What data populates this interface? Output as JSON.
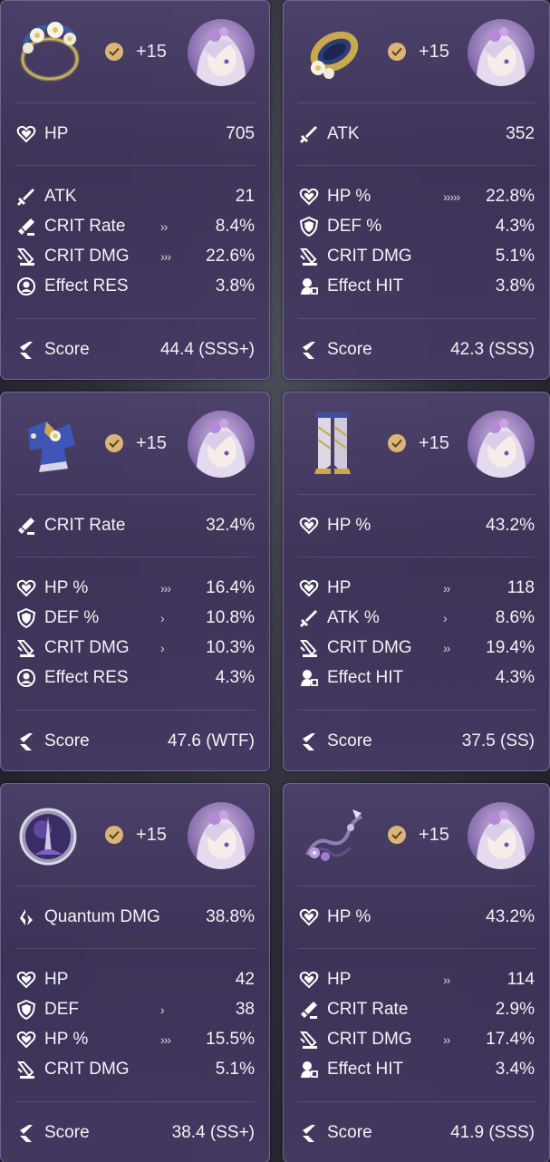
{
  "cards": [
    {
      "relic_icon": "headgear-flower-wreath-icon",
      "level": "+15",
      "main": {
        "icon": "hp-icon",
        "name": "HP",
        "value": "705"
      },
      "subs": [
        {
          "icon": "atk-icon",
          "name": "ATK",
          "rolls": "",
          "value": "21"
        },
        {
          "icon": "crit-rate-icon",
          "name": "CRIT Rate",
          "rolls": "››",
          "value": "8.4%"
        },
        {
          "icon": "crit-dmg-icon",
          "name": "CRIT DMG",
          "rolls": "›››",
          "value": "22.6%"
        },
        {
          "icon": "effect-res-icon",
          "name": "Effect RES",
          "rolls": "",
          "value": "3.8%"
        }
      ],
      "score_label": "Score",
      "score": "44.4 (SSS+)"
    },
    {
      "relic_icon": "gloves-ring-icon",
      "level": "+15",
      "main": {
        "icon": "atk-icon",
        "name": "ATK",
        "value": "352"
      },
      "subs": [
        {
          "icon": "hp-icon",
          "name": "HP %",
          "rolls": "›››››",
          "value": "22.8%"
        },
        {
          "icon": "def-icon",
          "name": "DEF %",
          "rolls": "",
          "value": "4.3%"
        },
        {
          "icon": "crit-dmg-icon",
          "name": "CRIT DMG",
          "rolls": "",
          "value": "5.1%"
        },
        {
          "icon": "effect-hit-icon",
          "name": "Effect HIT",
          "rolls": "",
          "value": "3.8%"
        }
      ],
      "score_label": "Score",
      "score": "42.3 (SSS)"
    },
    {
      "relic_icon": "body-robe-icon",
      "level": "+15",
      "main": {
        "icon": "crit-rate-icon",
        "name": "CRIT Rate",
        "value": "32.4%"
      },
      "subs": [
        {
          "icon": "hp-icon",
          "name": "HP %",
          "rolls": "›››",
          "value": "16.4%"
        },
        {
          "icon": "def-icon",
          "name": "DEF %",
          "rolls": "›",
          "value": "10.8%"
        },
        {
          "icon": "crit-dmg-icon",
          "name": "CRIT DMG",
          "rolls": "›",
          "value": "10.3%"
        },
        {
          "icon": "effect-res-icon",
          "name": "Effect RES",
          "rolls": "",
          "value": "4.3%"
        }
      ],
      "score_label": "Score",
      "score": "47.6 (WTF)"
    },
    {
      "relic_icon": "boots-icon",
      "level": "+15",
      "main": {
        "icon": "hp-icon",
        "name": "HP %",
        "value": "43.2%"
      },
      "subs": [
        {
          "icon": "hp-icon",
          "name": "HP",
          "rolls": "››",
          "value": "118"
        },
        {
          "icon": "atk-icon",
          "name": "ATK %",
          "rolls": "›",
          "value": "8.6%"
        },
        {
          "icon": "crit-dmg-icon",
          "name": "CRIT DMG",
          "rolls": "››",
          "value": "19.4%"
        },
        {
          "icon": "effect-hit-icon",
          "name": "Effect HIT",
          "rolls": "",
          "value": "4.3%"
        }
      ],
      "score_label": "Score",
      "score": "37.5 (SS)"
    },
    {
      "relic_icon": "planar-sphere-icon",
      "level": "+15",
      "main": {
        "icon": "quantum-dmg-icon",
        "name": "Quantum DMG",
        "value": "38.8%"
      },
      "subs": [
        {
          "icon": "hp-icon",
          "name": "HP",
          "rolls": "",
          "value": "42"
        },
        {
          "icon": "def-icon",
          "name": "DEF",
          "rolls": "›",
          "value": "38"
        },
        {
          "icon": "hp-icon",
          "name": "HP %",
          "rolls": "›››",
          "value": "15.5%"
        },
        {
          "icon": "crit-dmg-icon",
          "name": "CRIT DMG",
          "rolls": "",
          "value": "5.1%"
        }
      ],
      "score_label": "Score",
      "score": "38.4 (SS+)"
    },
    {
      "relic_icon": "link-rope-icon",
      "level": "+15",
      "main": {
        "icon": "hp-icon",
        "name": "HP %",
        "value": "43.2%"
      },
      "subs": [
        {
          "icon": "hp-icon",
          "name": "HP",
          "rolls": "››",
          "value": "114"
        },
        {
          "icon": "crit-rate-icon",
          "name": "CRIT Rate",
          "rolls": "",
          "value": "2.9%"
        },
        {
          "icon": "crit-dmg-icon",
          "name": "CRIT DMG",
          "rolls": "››",
          "value": "17.4%"
        },
        {
          "icon": "effect-hit-icon",
          "name": "Effect HIT",
          "rolls": "",
          "value": "3.4%"
        }
      ],
      "score_label": "Score",
      "score": "41.9 (SSS)"
    }
  ],
  "colors": {
    "card_bg": "#4e426c",
    "badge_gold": "#d9b577",
    "text": "#ffffff"
  }
}
